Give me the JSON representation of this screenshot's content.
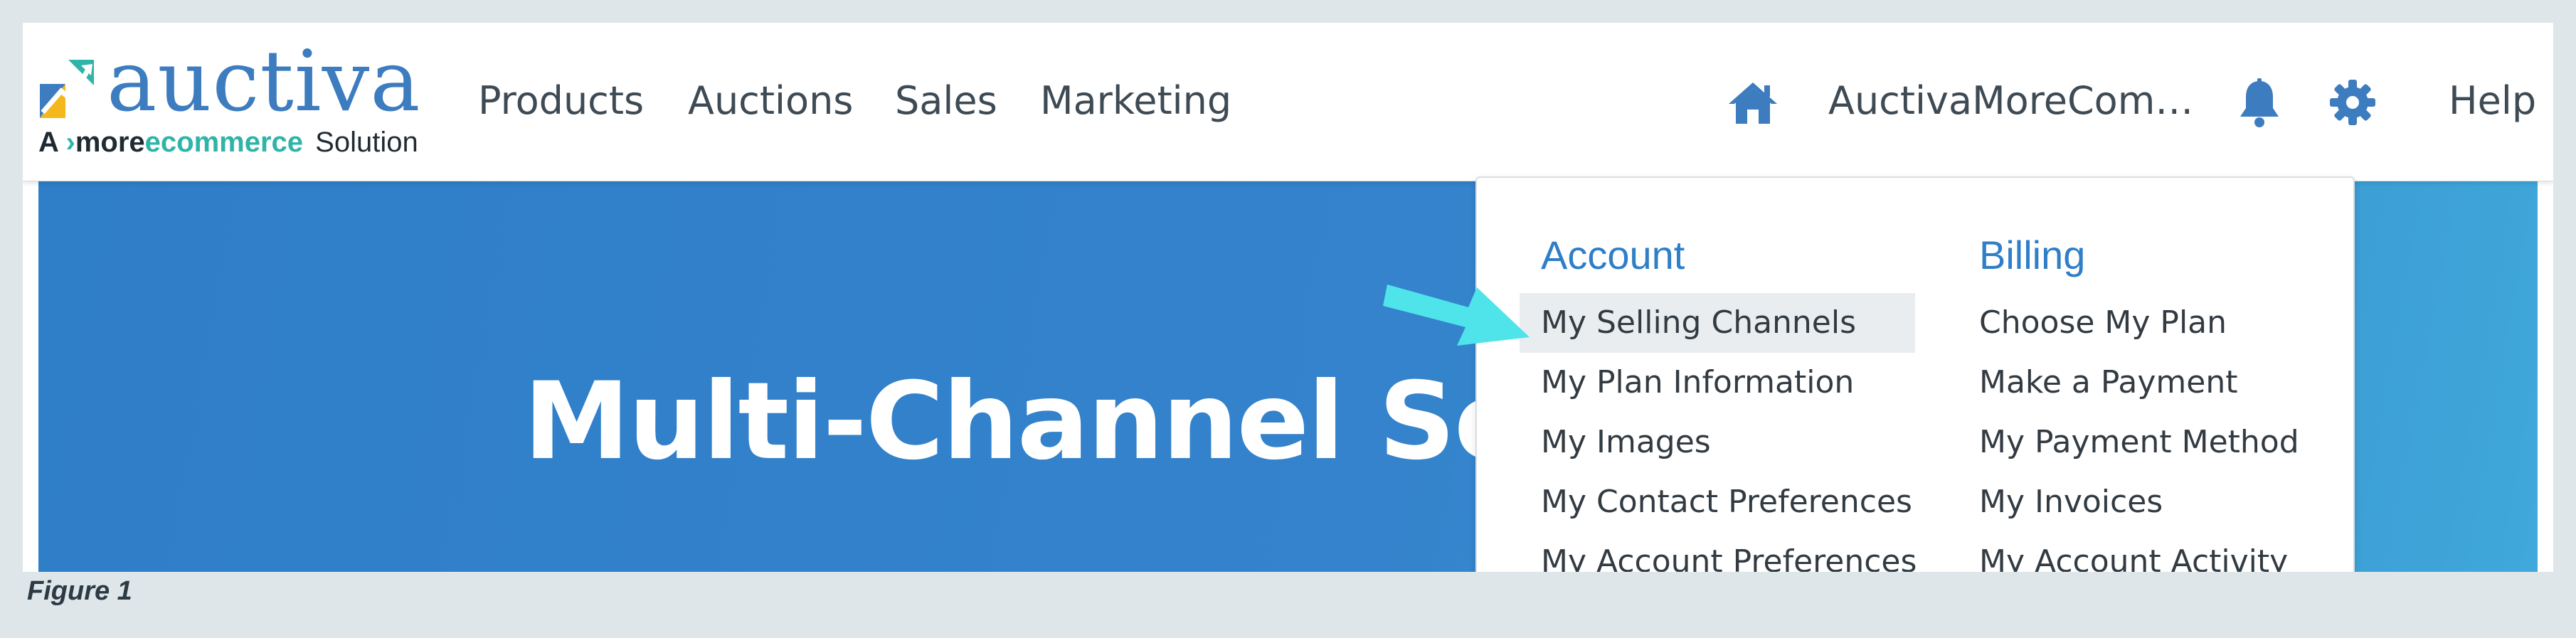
{
  "logo": {
    "brand": "auctiva",
    "tag_prefix": "A",
    "tag_more": "more",
    "tag_ecommerce": "ecommerce",
    "tag_suffix": "Solution"
  },
  "nav": {
    "items": [
      "Products",
      "Auctions",
      "Sales",
      "Marketing"
    ],
    "account_name": "AuctivaMoreCom…",
    "help": "Help"
  },
  "icons": {
    "home": "home-icon",
    "notifications": "bell-icon",
    "settings": "gear-icon",
    "pointer": "arrow-icon"
  },
  "hero": {
    "title": "Multi-Channel Sellin"
  },
  "dropdown": {
    "account": {
      "heading": "Account",
      "items": [
        "My Selling Channels",
        "My Plan Information",
        "My Images",
        "My Contact Preferences",
        "My Account Preferences"
      ]
    },
    "billing": {
      "heading": "Billing",
      "items": [
        "Choose My Plan",
        "Make a Payment",
        "My Payment Method",
        "My Invoices",
        "My Account Activity"
      ]
    }
  },
  "caption": "Figure 1",
  "colors": {
    "brand_blue": "#3c7cbf",
    "hero_blue": "#3483cc",
    "highlight_arrow": "#4fe3ea",
    "heading_blue": "#2f7ec8"
  }
}
